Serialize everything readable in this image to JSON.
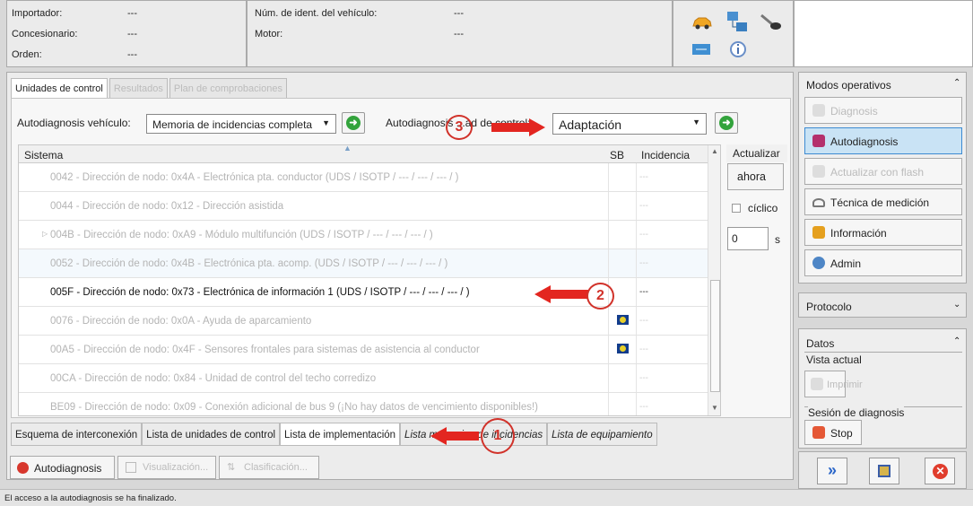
{
  "header": {
    "labels": [
      "Importador:",
      "Concesionario:",
      "Orden:"
    ],
    "values": [
      "---",
      "---",
      "---"
    ],
    "vehicle_labels": [
      "Núm. de ident. del vehículo:",
      "Motor:"
    ],
    "vehicle_values": [
      "---",
      "---"
    ]
  },
  "tabs": [
    "Unidades de control",
    "Resultados",
    "Plan de comprobaciones"
  ],
  "toolbar": {
    "label1": "Autodiagnosis vehículo:",
    "select1": "Memoria de incidencias completa",
    "label2": "Autodiagnosis ...ad de control:",
    "select2": "Adaptación"
  },
  "grid": {
    "col_system": "Sistema",
    "col_sb": "SB",
    "col_incidencia": "Incidencia",
    "rows": [
      {
        "text": "0042 - Dirección de nodo: 0x4A - Electrónica pta. conductor  (UDS / ISOTP / --- / --- / --- / )",
        "inc": "---"
      },
      {
        "text": "0044 - Dirección de nodo: 0x12 - Dirección asistida",
        "inc": "---"
      },
      {
        "text": "004B - Dirección de nodo: 0xA9 - Módulo multifunción  (UDS / ISOTP / --- / --- / --- / )",
        "inc": "---"
      },
      {
        "text": "0052 - Dirección de nodo: 0x4B - Electrónica pta. acomp.  (UDS / ISOTP / --- / --- / --- / )",
        "inc": "---"
      },
      {
        "text": "005F - Dirección de nodo: 0x73 - Electrónica de información 1  (UDS / ISOTP / --- / --- / --- / )",
        "inc": "---"
      },
      {
        "text": "0076 - Dirección de nodo: 0x0A - Ayuda de aparcamiento",
        "inc": "---"
      },
      {
        "text": "00A5 - Dirección de nodo: 0x4F - Sensores frontales para sistemas de asistencia al conductor",
        "inc": "---"
      },
      {
        "text": "00CA - Dirección de nodo: 0x84 - Unidad de control del techo corredizo",
        "inc": "---"
      },
      {
        "text": "BE09 - Dirección de nodo: 0x09 - Conexión adicional de bus 9  (¡No hay datos de vencimiento disponibles!)",
        "inc": "---"
      }
    ]
  },
  "actualizar": {
    "title": "Actualizar",
    "now": "ahora",
    "cyclic": "cíclico",
    "interval": "0",
    "unit": "s"
  },
  "bottom_tabs": [
    "Esquema de interconexión",
    "Lista de unidades de control",
    "Lista de implementación",
    "Lista memorias de incidencias",
    "Lista de equipamiento"
  ],
  "footer_buttons": [
    "Autodiagnosis",
    "Visualización...",
    "Clasificación..."
  ],
  "right": {
    "modos_title": "Modos operativos",
    "modes": [
      "Diagnosis",
      "Autodiagnosis",
      "Actualizar con flash",
      "Técnica de medición",
      "Información",
      "Admin"
    ],
    "protocolo": "Protocolo",
    "datos": "Datos",
    "vista_actual": "Vista actual",
    "imprimir": "Imprimir",
    "sesion": "Sesión de diagnosis",
    "stop": "Stop"
  },
  "annotations": [
    "3",
    "2",
    "1"
  ],
  "status": "El acceso a la autodiagnosis se ha finalizado.",
  "colors": {
    "accent": "#3d8bd2",
    "arrow": "#e32620",
    "go": "#33a33c"
  }
}
